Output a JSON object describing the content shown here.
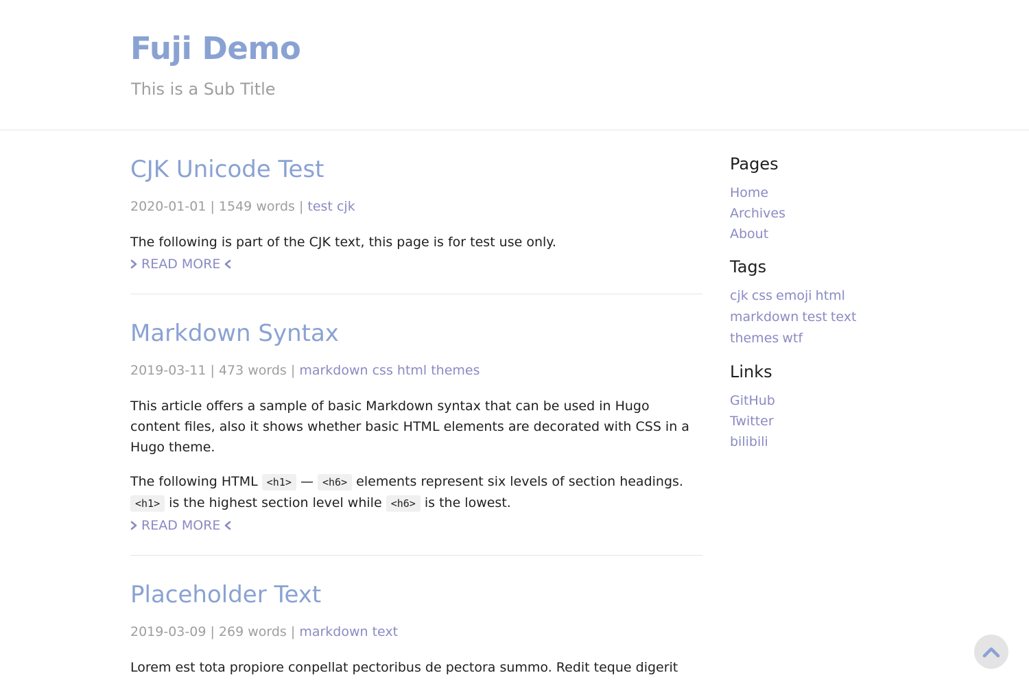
{
  "site": {
    "title": "Fuji Demo",
    "subtitle": "This is a Sub Title"
  },
  "posts": [
    {
      "title": "CJK Unicode Test",
      "date": "2020-01-01",
      "words": "1549 words",
      "tags": [
        "test",
        "cjk"
      ],
      "paragraphs": [
        "The following is part of the CJK text, this page is for test use only."
      ],
      "read_more": "READ MORE"
    },
    {
      "title": "Markdown Syntax",
      "date": "2019-03-11",
      "words": "473 words",
      "tags": [
        "markdown",
        "css",
        "html",
        "themes"
      ],
      "paragraphs": [
        "This article offers a sample of basic Markdown syntax that can be used in Hugo content files, also it shows whether basic HTML elements are decorated with CSS in a Hugo theme."
      ],
      "p2": {
        "t1": "The following HTML",
        "c1": "<h1>",
        "t2": "—",
        "c2": "<h6>",
        "t3": "elements represent six levels of section headings.",
        "c3": "<h1>",
        "t4": "is the highest section level while",
        "c4": "<h6>",
        "t5": "is the lowest."
      },
      "read_more": "READ MORE"
    },
    {
      "title": "Placeholder Text",
      "date": "2019-03-09",
      "words": "269 words",
      "tags": [
        "markdown",
        "text"
      ],
      "paragraphs": [
        "Lorem est tota propiore conpellat pectoribus de pectora summo. Redit teque digerit"
      ]
    }
  ],
  "sidebar": {
    "pages_heading": "Pages",
    "pages": [
      "Home",
      "Archives",
      "About"
    ],
    "tags_heading": "Tags",
    "tags": [
      "cjk",
      "css",
      "emoji",
      "html",
      "markdown",
      "test",
      "text",
      "themes",
      "wtf"
    ],
    "links_heading": "Links",
    "links": [
      "GitHub",
      "Twitter",
      "bilibili"
    ]
  },
  "icons": {
    "read_more_left": "chevron-right-icon",
    "read_more_right": "chevron-left-icon",
    "back_to_top": "chevron-up-icon"
  },
  "colors": {
    "title": "#8aa2d3",
    "link": "#8a8ac4",
    "meta": "#9e9e9e",
    "text": "#1f1f1f"
  }
}
